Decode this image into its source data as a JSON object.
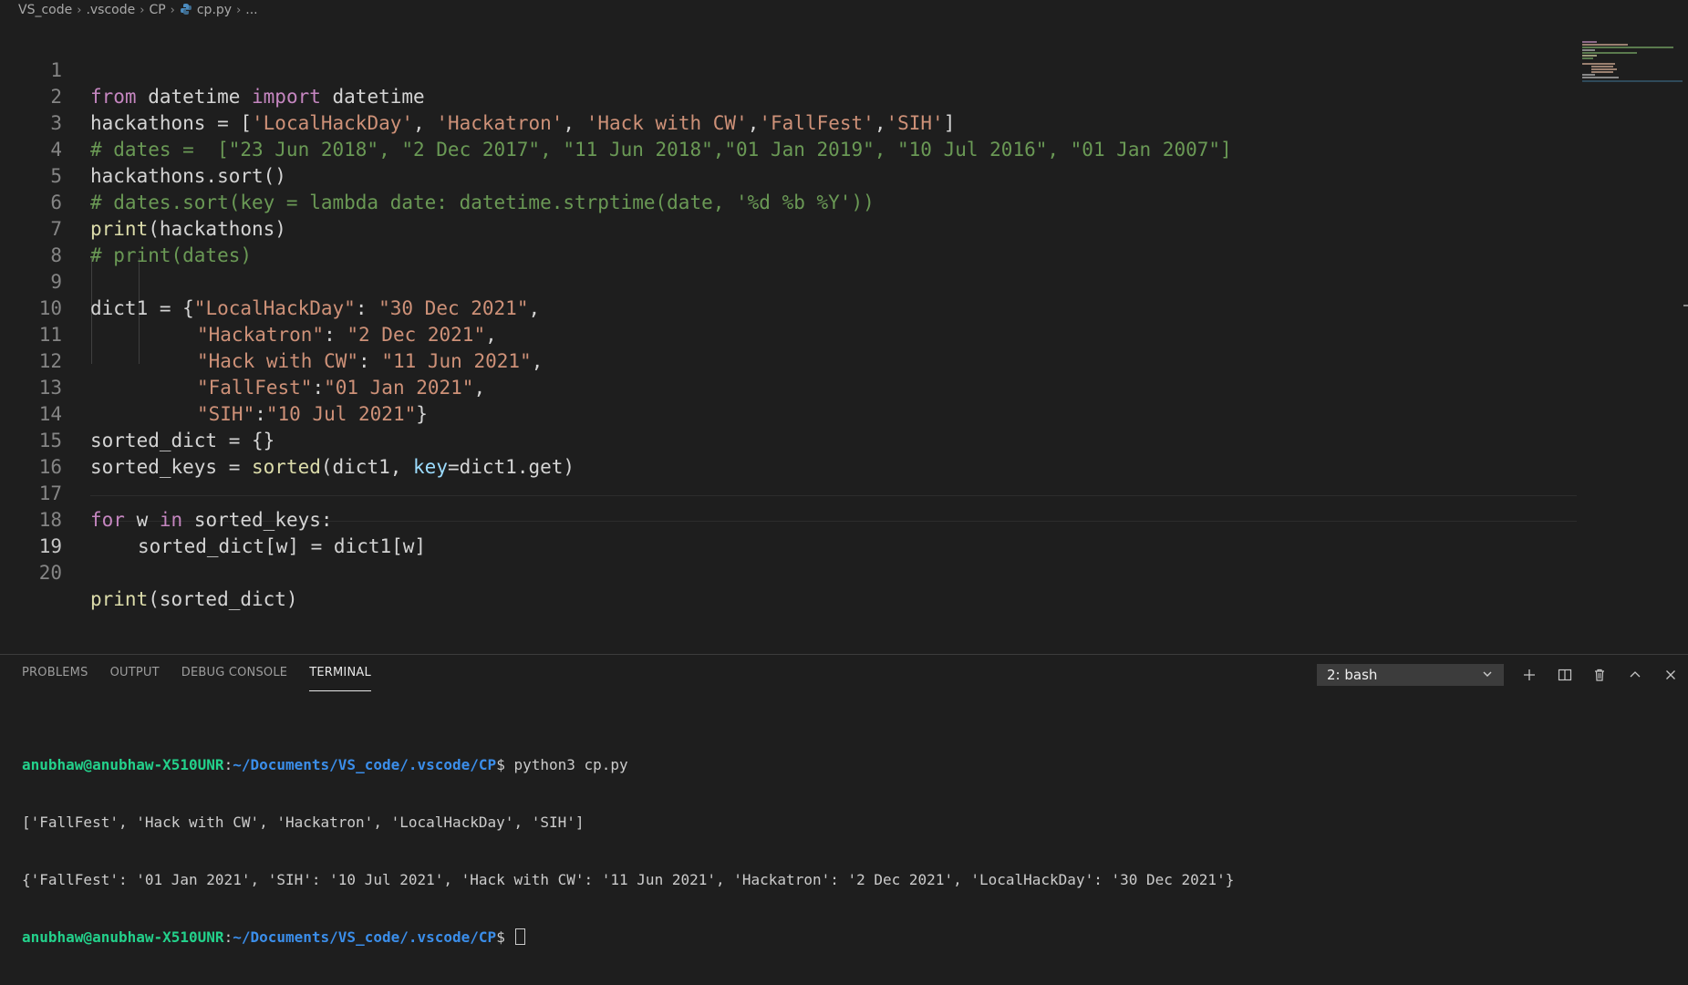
{
  "breadcrumb": {
    "items": [
      "VS_code",
      ".vscode",
      "CP",
      "cp.py",
      "..."
    ],
    "file_icon": "python-icon"
  },
  "editor": {
    "line_numbers": [
      "1",
      "2",
      "3",
      "4",
      "5",
      "6",
      "7",
      "8",
      "9",
      "10",
      "11",
      "12",
      "13",
      "14",
      "15",
      "16",
      "17",
      "18",
      "19",
      "20"
    ],
    "active_line": 19,
    "code": {
      "l1": {
        "a": "from",
        "b": " datetime ",
        "c": "import",
        "d": " datetime"
      },
      "l2": {
        "a": "hackathons = [",
        "b": "'LocalHackDay'",
        "c": ", ",
        "d": "'Hackatron'",
        "e": ", ",
        "f": "'Hack with CW'",
        "g": ",",
        "h": "'FallFest'",
        "i": ",",
        "j": "'SIH'",
        "k": "]"
      },
      "l3": {
        "a": "# dates =  [\"23 Jun 2018\", \"2 Dec 2017\", \"11 Jun 2018\",\"01 Jan 2019\", \"10 Jul 2016\", \"01 Jan 2007\"]"
      },
      "l4": {
        "a": "hackathons.sort()"
      },
      "l5": {
        "a": "# dates.sort(key = lambda date: datetime.strptime(date, '%d %b %Y'))"
      },
      "l6": {
        "a": "print",
        "b": "(hackathons)"
      },
      "l7": {
        "a": "# print(dates)"
      },
      "l9": {
        "a": "dict1 = {",
        "b": "\"LocalHackDay\"",
        "c": ": ",
        "d": "\"30 Dec 2021\"",
        "e": ","
      },
      "l10": {
        "b": "\"Hackatron\"",
        "c": ": ",
        "d": "\"2 Dec 2021\"",
        "e": ","
      },
      "l11": {
        "b": "\"Hack with CW\"",
        "c": ": ",
        "d": "\"11 Jun 2021\"",
        "e": ","
      },
      "l12": {
        "b": "\"FallFest\"",
        "c": ":",
        "d": "\"01 Jan 2021\"",
        "e": ","
      },
      "l13": {
        "b": "\"SIH\"",
        "c": ":",
        "d": "\"10 Jul 2021\"",
        "e": "}"
      },
      "l14": {
        "a": "sorted_dict = {}"
      },
      "l15": {
        "a": "sorted_keys = ",
        "b": "sorted",
        "c": "(dict1, ",
        "d": "key",
        "e": "=dict1.get)"
      },
      "l17": {
        "a": "for",
        "b": " w ",
        "c": "in",
        "d": " sorted_keys:"
      },
      "l18": {
        "a": "sorted_dict[w] = dict1[w]"
      },
      "l20": {
        "a": "print",
        "b": "(sorted_dict)"
      }
    }
  },
  "panel": {
    "tabs": [
      "PROBLEMS",
      "OUTPUT",
      "DEBUG CONSOLE",
      "TERMINAL"
    ],
    "active_tab": "TERMINAL",
    "terminal_select": "2: bash",
    "actions": [
      "add-terminal-icon",
      "split-terminal-icon",
      "trash-icon",
      "maximize-panel-icon",
      "close-panel-icon"
    ]
  },
  "terminal": {
    "user": "anubhaw@anubhaw-X510UNR",
    "path": "~/Documents/VS_code/.vscode/CP",
    "command": "python3 cp.py",
    "output1": "['FallFest', 'Hack with CW', 'Hackatron', 'LocalHackDay', 'SIH']",
    "output2": "{'FallFest': '01 Jan 2021', 'SIH': '10 Jul 2021', 'Hack with CW': '11 Jun 2021', 'Hackatron': '2 Dec 2021', 'LocalHackDay': '30 Dec 2021'}"
  },
  "colors": {
    "keyword": "#c586c0",
    "function": "#dcdcaa",
    "string": "#ce9178",
    "comment": "#6a9955",
    "parameter": "#9cdcfe",
    "terminal_user": "#23d18b",
    "terminal_path": "#3b8eea"
  }
}
